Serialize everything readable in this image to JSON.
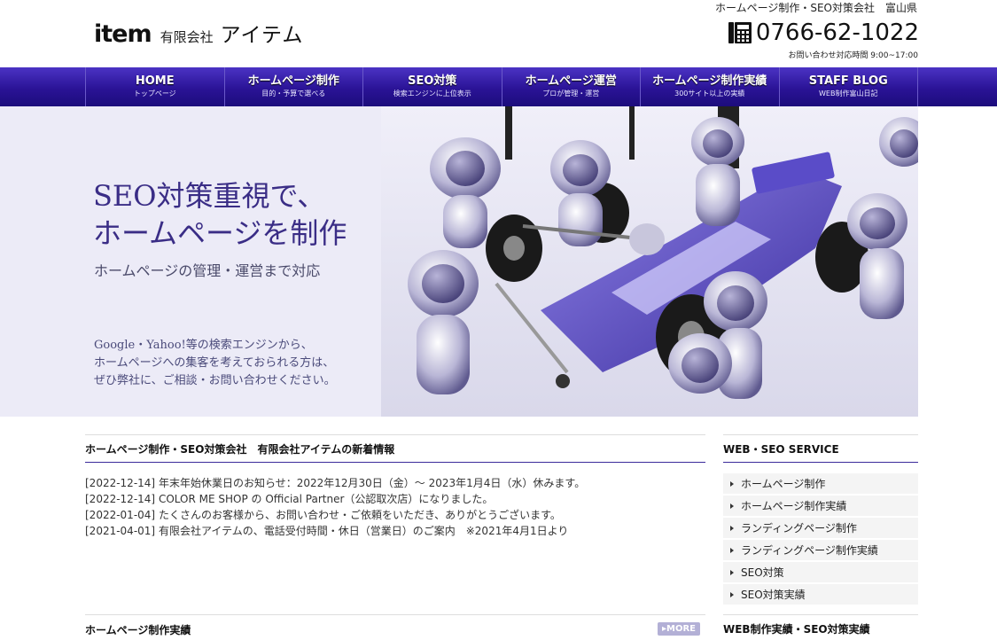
{
  "header": {
    "logo_mark": "item",
    "logo_company_type": "有限会社",
    "logo_name": "アイテム",
    "tagline": "ホームページ制作・SEO対策会社　富山県",
    "phone_number": "0766-62-1022",
    "hours": "お問い合わせ対応時間  9:00~17:00",
    "phone_icon": "telephone-icon"
  },
  "nav": {
    "items": [
      {
        "label": "HOME",
        "sub": "トップページ"
      },
      {
        "label": "ホームページ制作",
        "sub": "目的・予算で選べる"
      },
      {
        "label": "SEO対策",
        "sub": "検索エンジンに上位表示"
      },
      {
        "label": "ホームページ運営",
        "sub": "プロが管理・運営"
      },
      {
        "label": "ホームページ制作実績",
        "sub": "300サイト以上の実績"
      },
      {
        "label": "STAFF BLOG",
        "sub": "WEB制作富山日記"
      }
    ]
  },
  "hero": {
    "title_line1": "SEO対策重視で、",
    "title_line2": "ホームページを制作",
    "subtitle": "ホームページの管理・運営まで対応",
    "body_line1": "Google・Yahoo!等の検索エンジンから、",
    "body_line2": "ホームページへの集客を考えておられる方は、",
    "body_line3": "ぜひ弊社に、ご相談・お問い合わせください。"
  },
  "news": {
    "heading": "ホームページ制作・SEO対策会社　有限会社アイテムの新着情報",
    "items": [
      {
        "date": "[2022-12-14]",
        "text": "年末年始休業日のお知らせ：2022年12月30日（金）〜 2023年1月4日（水）休みます。"
      },
      {
        "date": "[2022-12-14]",
        "text": "COLOR ME SHOP の Official Partner（公認取次店）になりました。"
      },
      {
        "date": "[2022-01-04]",
        "text": "たくさんのお客様から、お問い合わせ・ご依頼をいただき、ありがとうございます。"
      },
      {
        "date": "[2021-04-01]",
        "text": "有限会社アイテムの、電話受付時間・休日（営業日）のご案内　※2021年4月1日より"
      }
    ]
  },
  "works": {
    "heading": "ホームページ制作実績",
    "more_label": "MORE"
  },
  "sidebar": {
    "heading": "WEB・SEO SERVICE",
    "items": [
      "ホームページ制作",
      "ホームページ制作実績",
      "ランディングページ制作",
      "ランディングページ制作実績",
      "SEO対策",
      "SEO対策実績"
    ],
    "heading2": "WEB制作実績・SEO対策実績"
  },
  "colors": {
    "nav_top": "#4b33c4",
    "nav_bottom": "#1c0c7c",
    "hero_bg": "#ecebf7",
    "hero_title": "#3a2d86",
    "accent_line": "#3b2a9a"
  }
}
